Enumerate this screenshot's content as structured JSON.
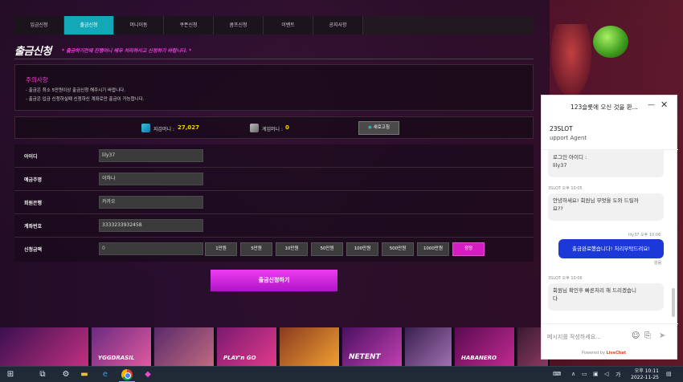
{
  "tabs": [
    "입금신청",
    "출금신청",
    "머니이동",
    "쿠폰신청",
    "콤프신청",
    "이벤트",
    "공지사항"
  ],
  "active_tab": 1,
  "page": {
    "title": "출금신청",
    "title_note": "* 출금하기전에 진행머니 배우 처리하시고 신청하기 바랍니다. *"
  },
  "notice": {
    "title": "주의사항",
    "line1": "- 출금은 최소 5만원이상 출금신청 해주시기 바랍니다.",
    "line2": "- 출금은 입금 신청하실때 신청하신 계좌로만 출금이 가능합니다."
  },
  "balance": {
    "wallet_label": "지갑머니 :",
    "wallet_value": "27,027",
    "game_label": "게임머니 :",
    "game_value": "0",
    "refresh_label": "새로고침"
  },
  "form": {
    "rows": [
      {
        "label": "아이디",
        "value": "lily37"
      },
      {
        "label": "예금주명",
        "value": "이하나"
      },
      {
        "label": "회원은행",
        "value": "카카오"
      },
      {
        "label": "계좌번호",
        "value": "3333233932458"
      }
    ],
    "amount_label": "신청금액",
    "amount_value": "0",
    "amount_buttons": [
      "1만원",
      "5만원",
      "10만원",
      "50만원",
      "100만원",
      "500만원",
      "1000만원",
      "정정"
    ]
  },
  "submit_label": "출금신청하기",
  "chat": {
    "title": "123슬롯에 오신 것을 환...",
    "brand": "23SLOT",
    "agent": "upport Agent",
    "msg1_line1": "로그인 아이디 :",
    "msg1_line2": "lily37",
    "meta2": "3SLOT 오후 10:05",
    "msg2_line1": "안녕하세요! 회원님 무엇을 도와 드릴까",
    "msg2_line2": "요??",
    "meta_out": "lily37 오후 10:06",
    "msg_out": "출금완료했습니다! 처리부탁드려요!",
    "read": "읽음",
    "meta3": "3SLOT 오후 10:06",
    "msg3_line1": "회원님 확인후 빠른처리 해 드리겠습니",
    "msg3_line2": "다",
    "input_placeholder": "메시지를 작성하세요...",
    "powered": "Powered by",
    "livechat": "LiveChat"
  },
  "games": [
    "",
    "YGGDRASIL",
    "PLAY'n GO",
    "",
    "NETENT",
    "",
    "HABANERO",
    ""
  ],
  "taskbar": {
    "time_line1": "오후 10:11",
    "time_line2": "2022-11-25"
  },
  "colors": {
    "accent_tab": "#12a8b8",
    "magenta": "#e64ad2",
    "wallet_yellow": "#f5d200",
    "chat_blue": "#1c38d6"
  }
}
